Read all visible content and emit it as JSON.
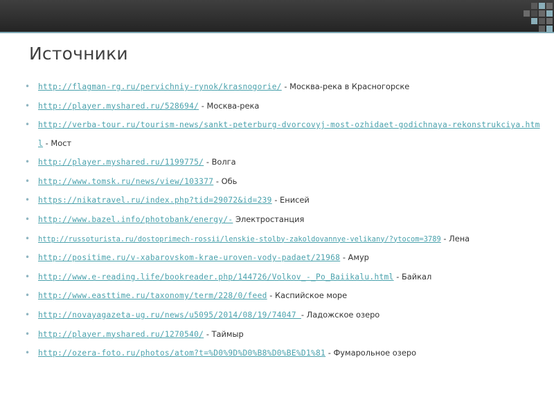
{
  "slide": {
    "title": "Источники",
    "bullet_glyph": "•",
    "sources": [
      {
        "url": "http://flagman-rg.ru/pervichniy-rynok/krasnogorie/",
        "desc": " - Москва-река в Красногорске"
      },
      {
        "url": "http://player.myshared.ru/528694/",
        "desc": " - Москва-река"
      },
      {
        "url": "http://verba-tour.ru/tourism-news/sankt-peterburg-dvorcovyj-most-ozhidaet-godichnaya-rekonstrukciya.html",
        "desc": " - Мост"
      },
      {
        "url": "http://player.myshared.ru/1199775/",
        "desc": "  - Волга"
      },
      {
        "url": "http://www.tomsk.ru/news/view/103377",
        "desc": " - Обь"
      },
      {
        "url": "https://nikatravel.ru/index.php?tid=29072&id=239",
        "desc": " - Енисей"
      },
      {
        "url": "http://www.bazel.info/photobank/energy/-",
        "desc": " Электростанция"
      },
      {
        "url": "http://russoturista.ru/dostoprimech-rossii/lenskie-stolby-zakoldovannye-velikany/?ytocom=3789",
        "desc": " - Лена"
      },
      {
        "url": "http://positime.ru/v-xabarovskom-krae-uroven-vody-padaet/21968",
        "desc": " - Амур"
      },
      {
        "url": "http://www.e-reading.life/bookreader.php/144726/Volkov_-_Po_Baiikalu.html",
        "desc": " - Байкал"
      },
      {
        "url": "http://www.easttime.ru/taxonomy/term/228/0/feed",
        "desc": " - Каспийское море"
      },
      {
        "url": "http://novayagazeta-ug.ru/news/u5095/2014/08/19/74047 ",
        "desc": "- Ладожское озеро"
      },
      {
        "url": "http://player.myshared.ru/1270540/",
        "desc": "  - Таймыр"
      },
      {
        "url": "http://ozera-foto.ru/photos/atom?t=%D0%9D%D0%B8%D0%BE%D1%81",
        "desc": " - Фумарольное озеро"
      }
    ]
  },
  "colors": {
    "link": "#49a1ac",
    "accent": "#8fb5c1",
    "text": "#333333",
    "bar": "#2d2d2d"
  }
}
